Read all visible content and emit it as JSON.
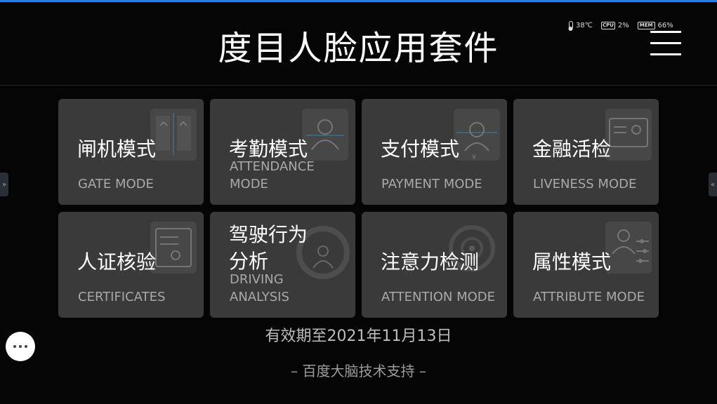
{
  "header": {
    "title": "度目人脸应用套件"
  },
  "status": {
    "temperature": "38℃",
    "cpu_chip": "CPU",
    "cpu": "2%",
    "mem_chip": "MEM",
    "mem": "66%"
  },
  "tiles": [
    {
      "cn": "闸机模式",
      "en": "GATE MODE",
      "icon": "gate-icon"
    },
    {
      "cn": "考勤模式",
      "en_line1": "ATTENDANCE",
      "en_line2": "MODE",
      "icon": "attendance-person-icon"
    },
    {
      "cn": "支付模式",
      "en": "PAYMENT MODE",
      "icon": "payment-face-icon"
    },
    {
      "cn": "金融活检",
      "en": "LIVENESS MODE",
      "icon": "liveness-card-icon"
    },
    {
      "cn": "人证核验",
      "en": "CERTIFICATES",
      "icon": "certificate-icon"
    },
    {
      "cn_line1": "驾驶行为",
      "cn_line2": "分析",
      "en_line1": "DRIVING",
      "en_line2": "ANALYSIS",
      "icon": "steering-wheel-icon"
    },
    {
      "cn": "注意力检测",
      "en": "ATTENTION MODE",
      "icon": "attention-target-icon"
    },
    {
      "cn": "属性模式",
      "en": "ATTRIBUTE MODE",
      "icon": "attribute-sliders-icon"
    }
  ],
  "footer": {
    "expiry": "有效期至2021年11月13日",
    "support": "– 百度大脑技术支持 –"
  },
  "side_tabs": {
    "left": "»",
    "right": "«"
  }
}
